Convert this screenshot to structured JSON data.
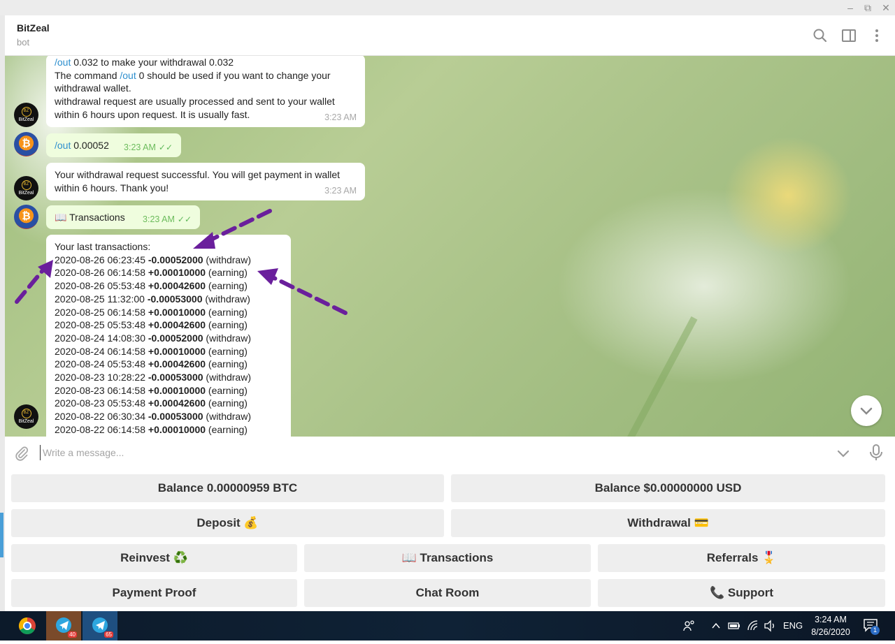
{
  "window": {
    "minimize": "–",
    "restore": "⧉",
    "close": "✕"
  },
  "header": {
    "title": "BitZeal",
    "subtitle": "bot"
  },
  "avatars": {
    "bot_text": "BitZeal",
    "bot_mark": "BZ",
    "user_mark": "₿"
  },
  "messages": [
    {
      "from": "bot",
      "lines": [
        {
          "link": "/out",
          "text": " 0.032 to make your withdrawal 0.032"
        },
        {
          "pre": "The command ",
          "link": "/out",
          "text": " 0 should be used if you want to change your"
        },
        {
          "text": "withdrawal wallet."
        },
        {
          "text": "withdrawal request are usually processed and sent to your wallet"
        },
        {
          "text": "within 6 hours upon request. It is usually fast."
        }
      ],
      "time": "3:23 AM"
    },
    {
      "from": "user",
      "link": "/out",
      "text": " 0.00052",
      "time": "3:23 AM",
      "ticks": "✓✓"
    },
    {
      "from": "bot",
      "lines": [
        {
          "text": "Your withdrawal request successful. You will get payment in wallet"
        },
        {
          "text": "within 6 hours. Thank you!"
        }
      ],
      "time": "3:23 AM"
    },
    {
      "from": "user",
      "text": "📖 Transactions",
      "time": "3:23 AM",
      "ticks": "✓✓"
    },
    {
      "from": "bot",
      "heading": "Your last transactions:",
      "transactions": [
        {
          "date": "2020-08-26 06:23:45",
          "amount": "-0.00052000",
          "type": "(withdraw)"
        },
        {
          "date": "2020-08-26 06:14:58",
          "amount": "+0.00010000",
          "type": "(earning)"
        },
        {
          "date": "2020-08-26 05:53:48",
          "amount": "+0.00042600",
          "type": "(earning)"
        },
        {
          "date": "2020-08-25 11:32:00",
          "amount": "-0.00053000",
          "type": "(withdraw)"
        },
        {
          "date": "2020-08-25 06:14:58",
          "amount": "+0.00010000",
          "type": "(earning)"
        },
        {
          "date": "2020-08-25 05:53:48",
          "amount": "+0.00042600",
          "type": "(earning)"
        },
        {
          "date": "2020-08-24 14:08:30",
          "amount": "-0.00052000",
          "type": "(withdraw)"
        },
        {
          "date": "2020-08-24 06:14:58",
          "amount": "+0.00010000",
          "type": "(earning)"
        },
        {
          "date": "2020-08-24 05:53:48",
          "amount": "+0.00042600",
          "type": "(earning)"
        },
        {
          "date": "2020-08-23 10:28:22",
          "amount": "-0.00053000",
          "type": "(withdraw)"
        },
        {
          "date": "2020-08-23 06:14:58",
          "amount": "+0.00010000",
          "type": "(earning)"
        },
        {
          "date": "2020-08-23 05:53:48",
          "amount": "+0.00042600",
          "type": "(earning)"
        },
        {
          "date": "2020-08-22 06:30:34",
          "amount": "-0.00053000",
          "type": "(withdraw)"
        },
        {
          "date": "2020-08-22 06:14:58",
          "amount": "+0.00010000",
          "type": "(earning)"
        }
      ]
    }
  ],
  "input": {
    "placeholder": "Write a message..."
  },
  "keyboard": {
    "rows": [
      [
        "Balance 0.00000959 BTC",
        "Balance $0.00000000 USD"
      ],
      [
        "Deposit 💰",
        "Withdrawal 💳"
      ],
      [
        "Reinvest ♻️",
        "📖 Transactions",
        "Referrals 🎖️"
      ],
      [
        "Payment Proof",
        "Chat Room",
        "📞 Support"
      ]
    ]
  },
  "taskbar": {
    "badges": [
      "40",
      "65"
    ],
    "language": "ENG",
    "time": "3:24 AM",
    "date": "8/26/2020",
    "notification_count": "1"
  },
  "colors": {
    "link": "#2d8fce",
    "annotation_arrow": "#6a1f9c",
    "telegram_blue": "#2ea6df"
  }
}
